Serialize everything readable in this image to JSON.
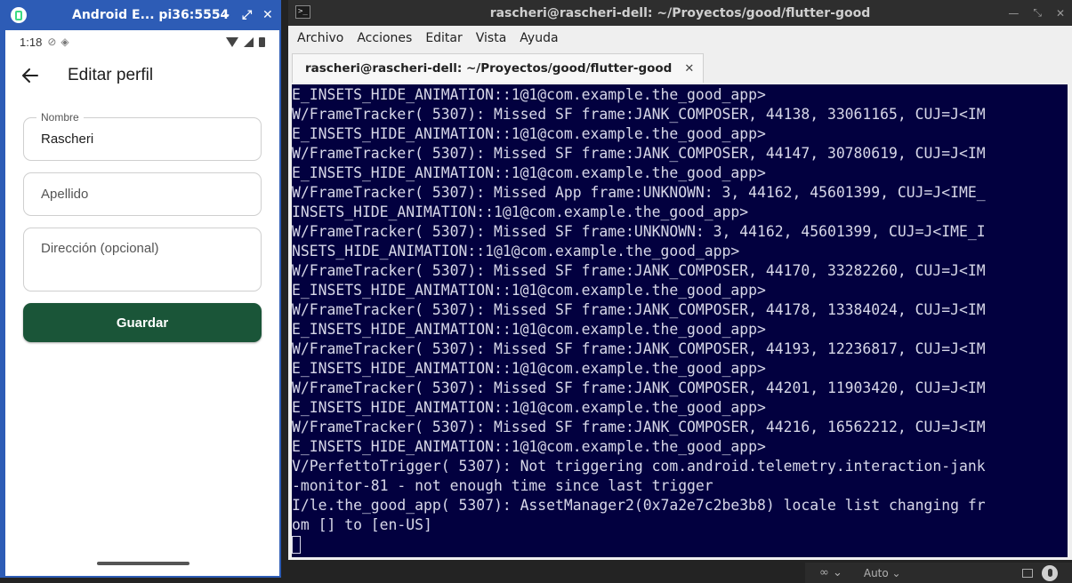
{
  "emulator": {
    "title": "Android E...  pi36:5554",
    "controls": [
      "–",
      "⤢",
      "✕"
    ],
    "status": {
      "time": "1:18"
    },
    "app": {
      "page_title": "Editar perfil",
      "fields": [
        {
          "label": "Nombre",
          "value": "Rascheri"
        },
        {
          "placeholder": "Apellido"
        },
        {
          "placeholder": "Dirección (opcional)"
        }
      ],
      "save_label": "Guardar",
      "accent": "#1a5538"
    }
  },
  "terminal": {
    "title": "rascheri@rascheri-dell: ~/Proyectos/good/flutter-good",
    "menu": [
      "Archivo",
      "Acciones",
      "Editar",
      "Vista",
      "Ayuda"
    ],
    "tab_label": "rascheri@rascheri-dell: ~/Proyectos/good/flutter-good",
    "background": "#02003f",
    "lines": [
      "E_INSETS_HIDE_ANIMATION::1@1@com.example.the_good_app>",
      "W/FrameTracker( 5307): Missed SF frame:JANK_COMPOSER, 44138, 33061165, CUJ=J<IM",
      "E_INSETS_HIDE_ANIMATION::1@1@com.example.the_good_app>",
      "W/FrameTracker( 5307): Missed SF frame:JANK_COMPOSER, 44147, 30780619, CUJ=J<IM",
      "E_INSETS_HIDE_ANIMATION::1@1@com.example.the_good_app>",
      "W/FrameTracker( 5307): Missed App frame:UNKNOWN: 3, 44162, 45601399, CUJ=J<IME_",
      "INSETS_HIDE_ANIMATION::1@1@com.example.the_good_app>",
      "W/FrameTracker( 5307): Missed SF frame:UNKNOWN: 3, 44162, 45601399, CUJ=J<IME_I",
      "NSETS_HIDE_ANIMATION::1@1@com.example.the_good_app>",
      "W/FrameTracker( 5307): Missed SF frame:JANK_COMPOSER, 44170, 33282260, CUJ=J<IM",
      "E_INSETS_HIDE_ANIMATION::1@1@com.example.the_good_app>",
      "W/FrameTracker( 5307): Missed SF frame:JANK_COMPOSER, 44178, 13384024, CUJ=J<IM",
      "E_INSETS_HIDE_ANIMATION::1@1@com.example.the_good_app>",
      "W/FrameTracker( 5307): Missed SF frame:JANK_COMPOSER, 44193, 12236817, CUJ=J<IM",
      "E_INSETS_HIDE_ANIMATION::1@1@com.example.the_good_app>",
      "W/FrameTracker( 5307): Missed SF frame:JANK_COMPOSER, 44201, 11903420, CUJ=J<IM",
      "E_INSETS_HIDE_ANIMATION::1@1@com.example.the_good_app>",
      "W/FrameTracker( 5307): Missed SF frame:JANK_COMPOSER, 44216, 16562212, CUJ=J<IM",
      "E_INSETS_HIDE_ANIMATION::1@1@com.example.the_good_app>",
      "V/PerfettoTrigger( 5307): Not triggering com.android.telemetry.interaction-jank",
      "-monitor-81 - not enough time since last trigger",
      "I/le.the_good_app( 5307): AssetManager2(0x7a2e7c2be3b8) locale list changing fr",
      "om [] to [en-US]"
    ]
  },
  "tray": {
    "mode_label": "Auto"
  }
}
